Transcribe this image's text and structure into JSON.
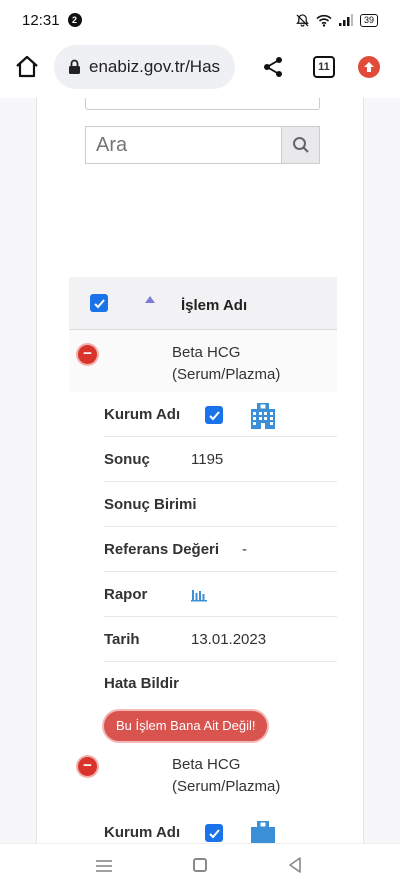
{
  "status": {
    "time": "12:31",
    "notif_count": "2",
    "battery": "39"
  },
  "browser": {
    "url": "enabiz.gov.tr/Has",
    "tab_count": "11"
  },
  "search": {
    "placeholder": "Ara"
  },
  "table": {
    "header_label": "İşlem Adı",
    "rows": [
      {
        "title_line1": "Beta HCG",
        "title_line2": "(Serum/Plazma)",
        "kurum_label": "Kurum Adı",
        "sonuc_label": "Sonuç",
        "sonuc_value": "1195",
        "birim_label": "Sonuç Birimi",
        "referans_label": "Referans Değeri",
        "referans_value": "-",
        "rapor_label": "Rapor",
        "tarih_label": "Tarih",
        "tarih_value": "13.01.2023",
        "hata_label": "Hata Bildir",
        "hata_button": "Bu İşlem Bana Ait Değil!"
      },
      {
        "title_line1": "Beta HCG",
        "title_line2": "(Serum/Plazma)",
        "kurum_label": "Kurum Adı"
      }
    ]
  },
  "colors": {
    "accent": "#1a73e8",
    "danger": "#d9342b",
    "icon_blue": "#3a8fd6"
  }
}
